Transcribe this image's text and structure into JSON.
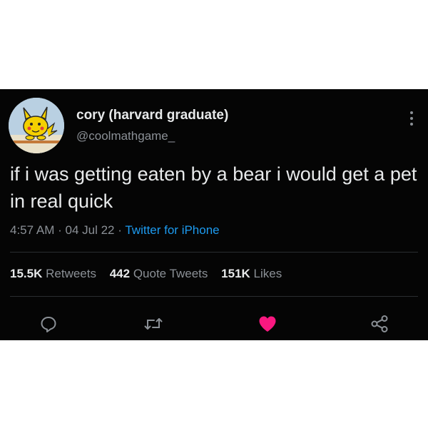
{
  "tweet": {
    "author": {
      "display_name": "cory (harvard graduate)",
      "handle": "@coolmathgame_"
    },
    "text": "if i was getting eaten by a bear i would get a pet in real quick",
    "time": "4:57 AM",
    "date": "04 Jul 22",
    "source": "Twitter for iPhone",
    "separator": "·",
    "stats": {
      "retweets": {
        "value": "15.5K",
        "label": "Retweets"
      },
      "quote_tweets": {
        "value": "442",
        "label": "Quote Tweets"
      },
      "likes": {
        "value": "151K",
        "label": "Likes"
      }
    },
    "liked": true
  },
  "icons": {
    "more": "more-vertical-icon",
    "reply": "reply-icon",
    "retweet": "retweet-icon",
    "like": "heart-icon",
    "share": "share-icon"
  },
  "colors": {
    "background": "#050505",
    "text": "#e7e9ea",
    "secondary_text": "#8b9096",
    "link": "#1d9bf0",
    "like": "#f91880"
  }
}
